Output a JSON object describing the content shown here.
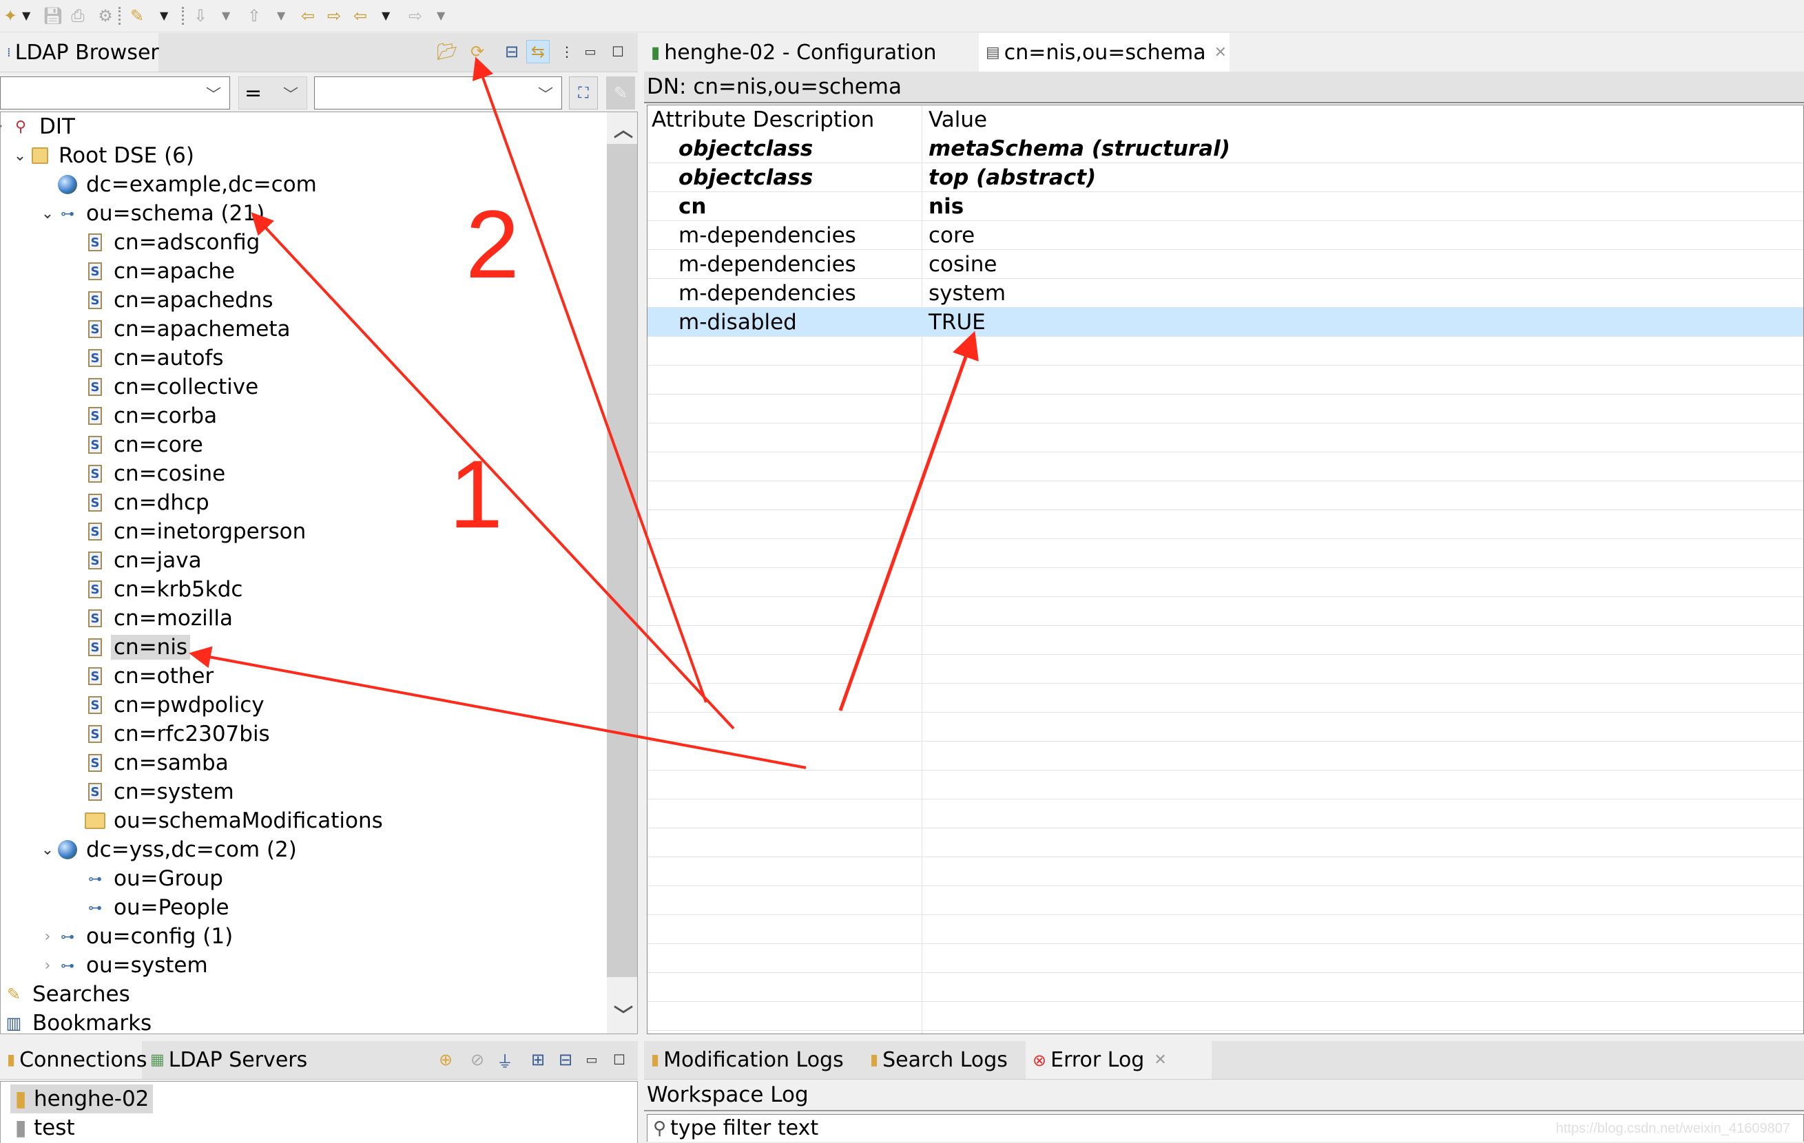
{
  "toolbar": {
    "items": [
      {
        "icon": "new-wizard-icon",
        "dropdown": true
      },
      {
        "icon": "save-icon",
        "dropdown": false
      },
      {
        "icon": "print-icon",
        "dropdown": false
      },
      {
        "icon": "properties-gear-icon",
        "dropdown": false
      },
      {
        "icon": "search-pen-icon",
        "dropdown": true
      },
      {
        "icon": "import-icon",
        "dropdown": true
      },
      {
        "icon": "export-icon",
        "dropdown": true
      },
      {
        "icon": "previous-edit-location-icon",
        "dropdown": false
      },
      {
        "icon": "next-edit-location-icon",
        "dropdown": false
      },
      {
        "icon": "back-icon",
        "dropdown": true
      },
      {
        "icon": "forward-icon",
        "dropdown": true
      }
    ]
  },
  "ldap_browser": {
    "tab_label": "LDAP Browser",
    "header_buttons": [
      "open-entry-icon",
      "refresh-icon",
      "collapse-all-icon",
      "link-with-editor-icon",
      "view-menu-icon",
      "minimize-icon",
      "maximize-icon"
    ],
    "filter": {
      "attribute_value": "",
      "operator_value": "=",
      "value_value": ""
    },
    "tree": [
      {
        "label": "DIT",
        "level": 0,
        "icon": "dit-icon",
        "expander": "partial"
      },
      {
        "label": "Root DSE (6)",
        "level": 1,
        "icon": "root-dse-icon",
        "expander": "expanded"
      },
      {
        "label": "dc=example,dc=com",
        "level": 2,
        "icon": "globe-icon",
        "expander": "none"
      },
      {
        "label": "ou=schema (21)",
        "level": 2,
        "icon": "ou-icon",
        "expander": "expanded"
      },
      {
        "label": "cn=adsconfig",
        "level": 3,
        "icon": "schema-icon",
        "expander": "none"
      },
      {
        "label": "cn=apache",
        "level": 3,
        "icon": "schema-icon",
        "expander": "none"
      },
      {
        "label": "cn=apachedns",
        "level": 3,
        "icon": "schema-icon",
        "expander": "none"
      },
      {
        "label": "cn=apachemeta",
        "level": 3,
        "icon": "schema-icon",
        "expander": "none"
      },
      {
        "label": "cn=autofs",
        "level": 3,
        "icon": "schema-icon",
        "expander": "none"
      },
      {
        "label": "cn=collective",
        "level": 3,
        "icon": "schema-icon",
        "expander": "none"
      },
      {
        "label": "cn=corba",
        "level": 3,
        "icon": "schema-icon",
        "expander": "none"
      },
      {
        "label": "cn=core",
        "level": 3,
        "icon": "schema-icon",
        "expander": "none"
      },
      {
        "label": "cn=cosine",
        "level": 3,
        "icon": "schema-icon",
        "expander": "none"
      },
      {
        "label": "cn=dhcp",
        "level": 3,
        "icon": "schema-icon",
        "expander": "none"
      },
      {
        "label": "cn=inetorgperson",
        "level": 3,
        "icon": "schema-icon",
        "expander": "none"
      },
      {
        "label": "cn=java",
        "level": 3,
        "icon": "schema-icon",
        "expander": "none"
      },
      {
        "label": "cn=krb5kdc",
        "level": 3,
        "icon": "schema-icon",
        "expander": "none"
      },
      {
        "label": "cn=mozilla",
        "level": 3,
        "icon": "schema-icon",
        "expander": "none"
      },
      {
        "label": "cn=nis",
        "level": 3,
        "icon": "schema-icon",
        "expander": "none",
        "selected": true
      },
      {
        "label": "cn=other",
        "level": 3,
        "icon": "schema-icon",
        "expander": "none"
      },
      {
        "label": "cn=pwdpolicy",
        "level": 3,
        "icon": "schema-icon",
        "expander": "none"
      },
      {
        "label": "cn=rfc2307bis",
        "level": 3,
        "icon": "schema-icon",
        "expander": "none"
      },
      {
        "label": "cn=samba",
        "level": 3,
        "icon": "schema-icon",
        "expander": "none"
      },
      {
        "label": "cn=system",
        "level": 3,
        "icon": "schema-icon",
        "expander": "none"
      },
      {
        "label": "ou=schemaModifications",
        "level": 3,
        "icon": "folder-icon",
        "expander": "none"
      },
      {
        "label": "dc=yss,dc=com (2)",
        "level": 2,
        "icon": "globe-icon",
        "expander": "expanded"
      },
      {
        "label": "ou=Group",
        "level": 3,
        "icon": "ou-icon",
        "expander": "none"
      },
      {
        "label": "ou=People",
        "level": 3,
        "icon": "ou-icon",
        "expander": "none"
      },
      {
        "label": "ou=config (1)",
        "level": 2,
        "icon": "ou-icon",
        "expander": "collapsed"
      },
      {
        "label": "ou=system",
        "level": 2,
        "icon": "ou-icon",
        "expander": "collapsed"
      },
      {
        "label": "Searches",
        "level": 0,
        "icon": "searches-icon",
        "expander": "none"
      },
      {
        "label": "Bookmarks",
        "level": 0,
        "icon": "bookmarks-icon",
        "expander": "none"
      }
    ]
  },
  "editor": {
    "tabs": [
      {
        "label": "henghe-02 - Configuration",
        "icon": "configuration-icon",
        "active": false,
        "closable": false
      },
      {
        "label": "cn=nis,ou=schema",
        "icon": "entry-editor-icon",
        "active": true,
        "closable": true
      }
    ],
    "dn_label": "DN: cn=nis,ou=schema",
    "columns": [
      "Attribute Description",
      "Value"
    ],
    "rows": [
      {
        "attribute": "objectclass",
        "value": "metaSchema (structural)",
        "style": "bold-italic"
      },
      {
        "attribute": "objectclass",
        "value": "top (abstract)",
        "style": "bold-italic"
      },
      {
        "attribute": "cn",
        "value": "nis",
        "style": "bold"
      },
      {
        "attribute": "m-dependencies",
        "value": "core",
        "style": "normal"
      },
      {
        "attribute": "m-dependencies",
        "value": "cosine",
        "style": "normal"
      },
      {
        "attribute": "m-dependencies",
        "value": "system",
        "style": "normal"
      },
      {
        "attribute": "m-disabled",
        "value": "TRUE",
        "style": "normal",
        "selected": true
      }
    ]
  },
  "connections": {
    "tabs": [
      {
        "label": "Connections",
        "icon": "connection-icon",
        "active": true
      },
      {
        "label": "LDAP Servers",
        "icon": "ldap-servers-icon",
        "active": false
      }
    ],
    "header_buttons": [
      "new-connection-icon",
      "close-connection-icon",
      "open-connection-icon",
      "expand-all-icon",
      "collapse-all-icon",
      "minimize-icon",
      "maximize-icon"
    ],
    "items": [
      {
        "label": "henghe-02",
        "status": "open",
        "selected": true
      },
      {
        "label": "test",
        "status": "closed",
        "selected": false
      }
    ]
  },
  "logs": {
    "tabs": [
      {
        "label": "Modification Logs",
        "icon": "log-icon",
        "active": false
      },
      {
        "label": "Search Logs",
        "icon": "log-icon",
        "active": false
      },
      {
        "label": "Error Log",
        "icon": "error-log-icon",
        "active": true,
        "closable": true
      }
    ],
    "workspace_label": "Workspace Log",
    "filter_placeholder": "type filter text"
  },
  "annotations": {
    "label_1": "1",
    "label_2": "2",
    "color": "#ff2a1a"
  },
  "watermark": "https://blog.csdn.net/weixin_41609807"
}
